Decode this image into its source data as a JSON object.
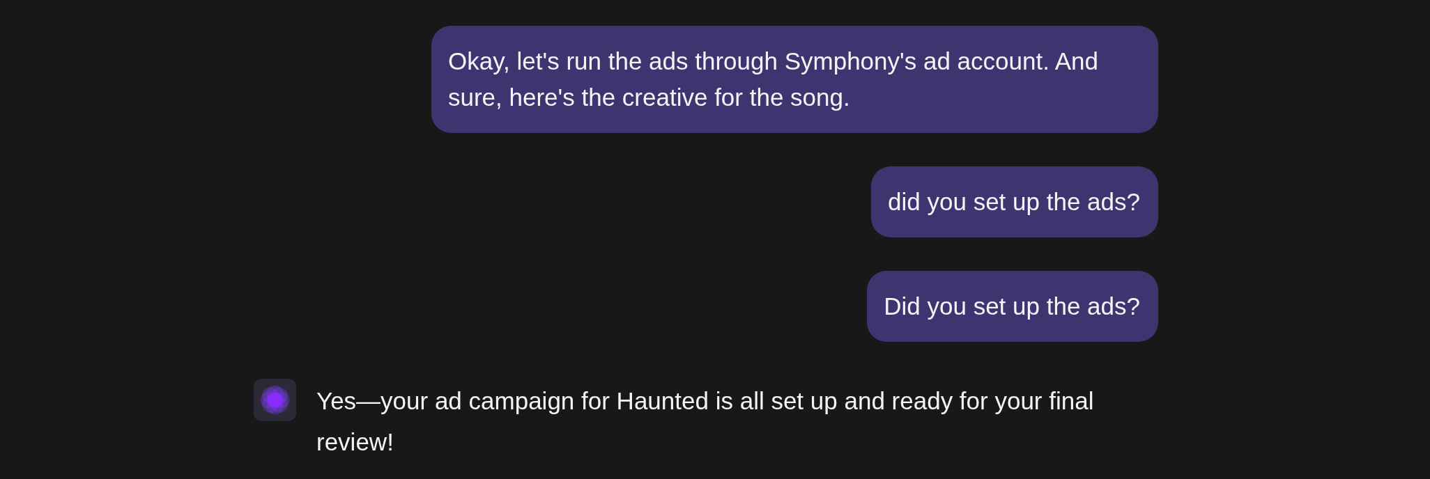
{
  "messages": [
    {
      "kind": "user",
      "text": "Okay, let's run the ads through Symphony's ad account. And sure, here's the creative for the song."
    },
    {
      "kind": "user",
      "text": "did you set up the ads?"
    },
    {
      "kind": "user",
      "text": "Did you set up the ads?"
    },
    {
      "kind": "assistant",
      "text": "Yes—your ad campaign for Haunted is all set up and ready for your final review!"
    }
  ]
}
